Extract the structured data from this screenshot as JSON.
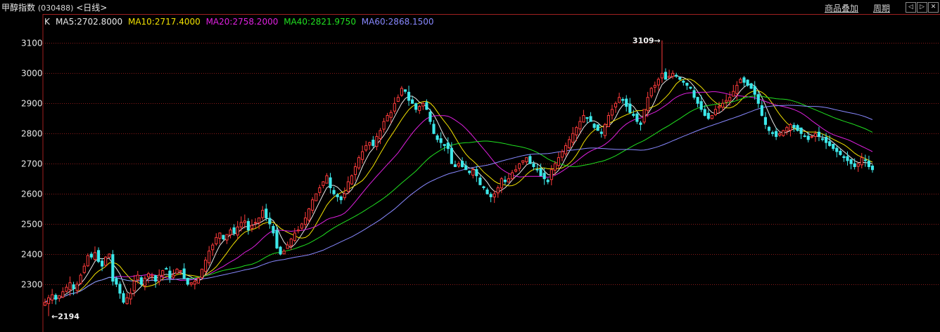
{
  "header": {
    "title": "甲醇指数",
    "code": "(030488)",
    "period": "<日线>",
    "links": [
      {
        "label": "商品叠加"
      },
      {
        "label": "周期"
      }
    ],
    "nav_buttons": [
      {
        "icon": "arrow-left-icon",
        "glyph": "◁"
      },
      {
        "icon": "arrow-right-icon",
        "glyph": "▷"
      },
      {
        "icon": "close-icon",
        "glyph": "✕"
      }
    ]
  },
  "legend": {
    "prefix": "K",
    "items": [
      {
        "label": "MA5:2702.8000",
        "color": "#e8e8e8"
      },
      {
        "label": "MA10:2717.4000",
        "color": "#f2e200"
      },
      {
        "label": "MA20:2758.2000",
        "color": "#e020e0"
      },
      {
        "label": "MA40:2821.9750",
        "color": "#20e020"
      },
      {
        "label": "MA60:2868.1500",
        "color": "#8888ff"
      }
    ]
  },
  "colors": {
    "up": "#ff3b3b",
    "down": "#3de8ea",
    "grid": "#8b1a1a",
    "frame": "#a02020"
  },
  "chart_data": {
    "type": "candlestick",
    "ylim": [
      2160,
      3150
    ],
    "y_ticks": [
      2300,
      2400,
      2500,
      2600,
      2700,
      2800,
      2900,
      3000,
      3100
    ],
    "grid": true,
    "annotations": {
      "high": {
        "text": "3109→",
        "value": 3109
      },
      "low": {
        "text": "←2194",
        "value": 2194
      }
    },
    "closes": [
      2240,
      2255,
      2265,
      2250,
      2262,
      2275,
      2290,
      2305,
      2285,
      2300,
      2330,
      2360,
      2395,
      2390,
      2405,
      2375,
      2360,
      2390,
      2400,
      2310,
      2300,
      2270,
      2240,
      2255,
      2270,
      2310,
      2330,
      2300,
      2320,
      2335,
      2330,
      2310,
      2330,
      2345,
      2350,
      2320,
      2330,
      2350,
      2345,
      2320,
      2300,
      2305,
      2310,
      2320,
      2350,
      2380,
      2410,
      2430,
      2455,
      2470,
      2450,
      2465,
      2480,
      2470,
      2490,
      2505,
      2510,
      2480,
      2495,
      2505,
      2520,
      2545,
      2520,
      2500,
      2470,
      2420,
      2400,
      2410,
      2430,
      2450,
      2470,
      2480,
      2500,
      2520,
      2550,
      2580,
      2600,
      2620,
      2640,
      2660,
      2620,
      2600,
      2590,
      2580,
      2600,
      2640,
      2660,
      2690,
      2720,
      2740,
      2760,
      2770,
      2760,
      2790,
      2810,
      2840,
      2860,
      2870,
      2900,
      2920,
      2950,
      2940,
      2910,
      2900,
      2880,
      2890,
      2900,
      2880,
      2840,
      2800,
      2780,
      2770,
      2760,
      2750,
      2700,
      2690,
      2700,
      2690,
      2680,
      2670,
      2680,
      2660,
      2630,
      2620,
      2600,
      2590,
      2600,
      2620,
      2650,
      2640,
      2650,
      2670,
      2680,
      2700,
      2710,
      2720,
      2700,
      2690,
      2680,
      2660,
      2650,
      2640,
      2680,
      2700,
      2720,
      2740,
      2760,
      2780,
      2800,
      2820,
      2840,
      2860,
      2850,
      2840,
      2820,
      2810,
      2800,
      2830,
      2860,
      2880,
      2900,
      2920,
      2910,
      2890,
      2870,
      2860,
      2840,
      2830,
      2880,
      2920,
      2950,
      2960,
      2980,
      3000,
      2980,
      2990,
      3000,
      2990,
      2980,
      2970,
      2960,
      2950,
      2920,
      2900,
      2880,
      2860,
      2850,
      2860,
      2880,
      2890,
      2900,
      2910,
      2920,
      2940,
      2960,
      2980,
      2970,
      2960,
      2950,
      2930,
      2900,
      2860,
      2830,
      2810,
      2800,
      2790,
      2800,
      2810,
      2820,
      2830,
      2820,
      2810,
      2800,
      2790,
      2780,
      2790,
      2800,
      2790,
      2780,
      2770,
      2760,
      2750,
      2740,
      2730,
      2720,
      2710,
      2700,
      2690,
      2700,
      2720,
      2710,
      2690,
      2680
    ]
  }
}
